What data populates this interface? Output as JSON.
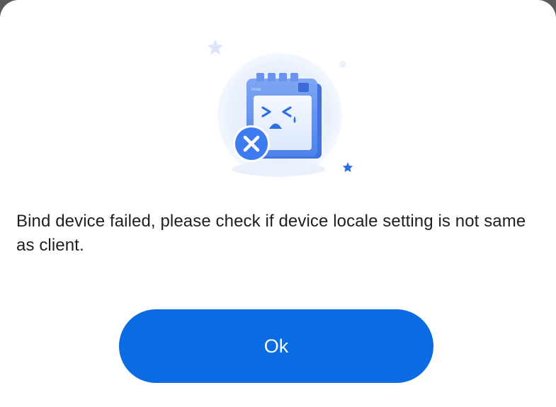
{
  "dialog": {
    "illustration_icon": "device-bind-failed-illustration",
    "calendar_brand_text": "Imou",
    "message": "Bind device failed, please check if device locale setting is not same as client.",
    "ok_label": "Ok"
  },
  "colors": {
    "accent": "#0A6BE3",
    "error_badge": "#3E7BF0",
    "text": "#1F1F1F",
    "background": "#FFFFFF"
  }
}
